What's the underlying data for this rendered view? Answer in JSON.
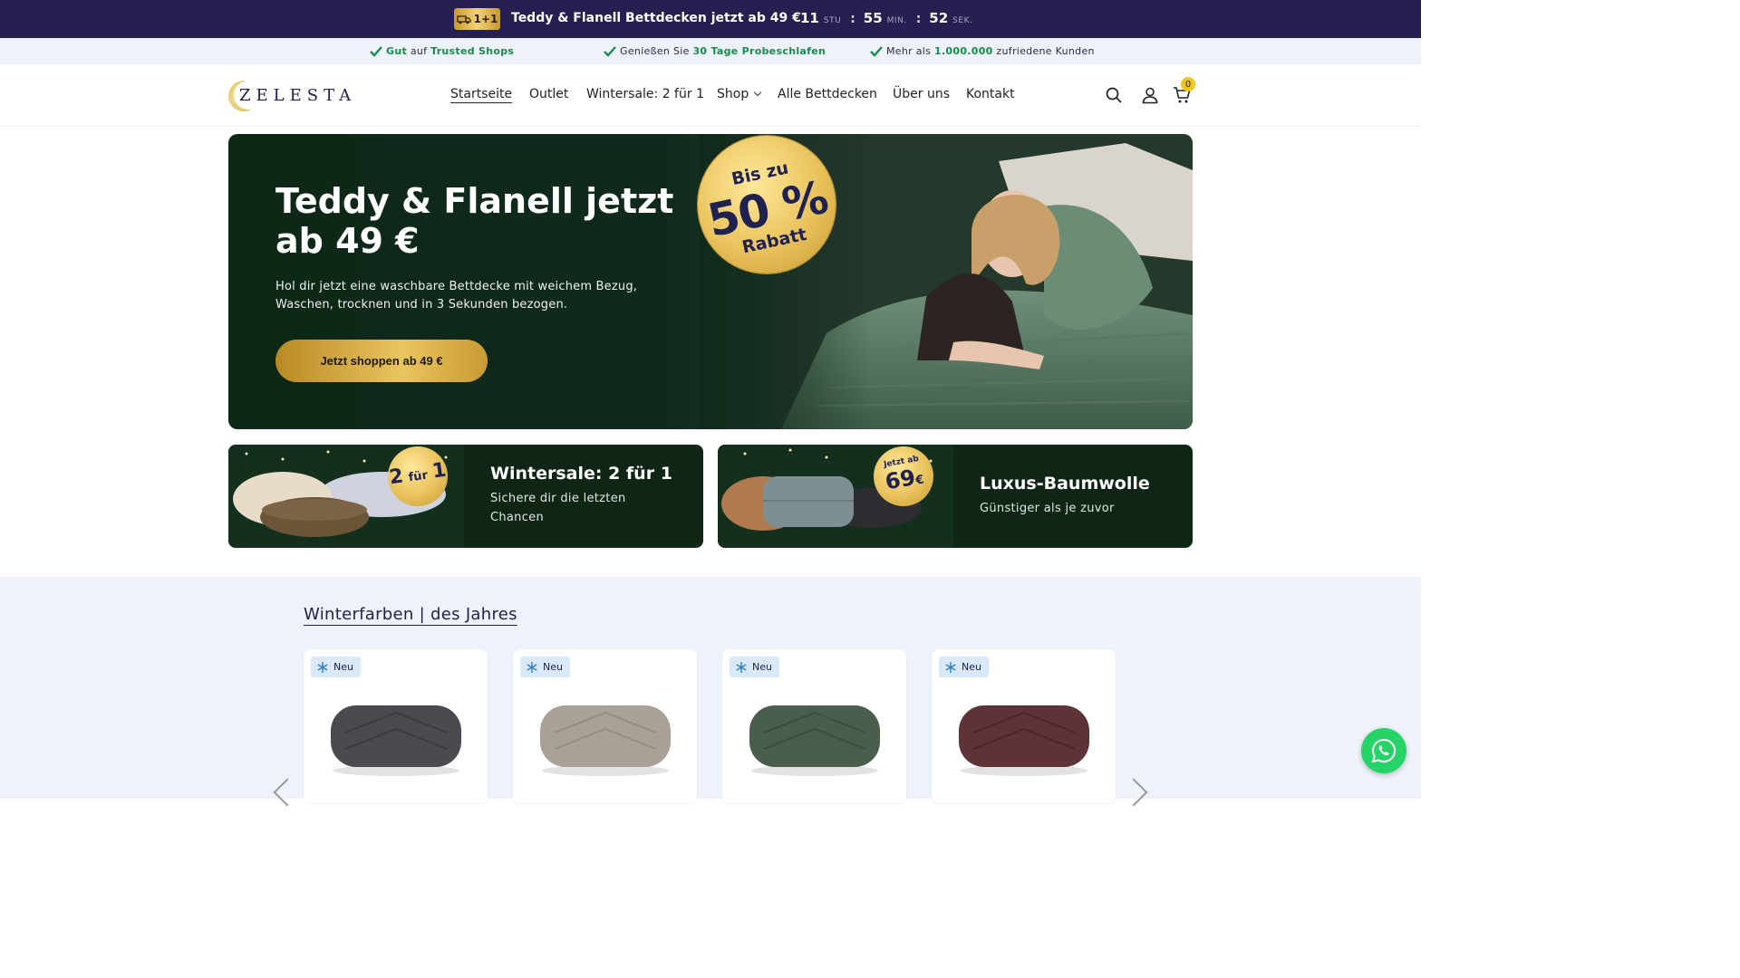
{
  "announcement": {
    "badge": "1+1",
    "message": "Teddy & Flanell Bettdecken jetzt ab 49 €",
    "timer": [
      {
        "value": "11",
        "unit": "STU"
      },
      {
        "value": "55",
        "unit": "MIN."
      },
      {
        "value": "52",
        "unit": "SEK."
      }
    ],
    "separator": ":"
  },
  "trust": [
    {
      "pre": "Gut",
      "mid": " auf ",
      "em": "Trusted Shops",
      "post": ""
    },
    {
      "pre": "",
      "mid": "Genießen Sie ",
      "em": "30 Tage Probeschlafen",
      "post": ""
    },
    {
      "pre": "",
      "mid": "Mehr als ",
      "em": "1.000.000",
      "post": " zufriedene Kunden"
    }
  ],
  "logo": "ZELESTA",
  "nav": [
    {
      "label": "Startseite",
      "active": true
    },
    {
      "label": "Outlet"
    },
    {
      "label": "Wintersale: 2 für 1"
    },
    {
      "label": "Shop"
    },
    {
      "label": "Alle Bettdecken"
    },
    {
      "label": "Über uns"
    },
    {
      "label": "Kontakt"
    }
  ],
  "header_icons": [
    "search-icon",
    "account-icon",
    "cart-icon"
  ],
  "cart_count": "0",
  "hero": {
    "title": "Teddy & Flanell jetzt ab 49 €",
    "text": "Hol dir jetzt eine waschbare Bettdecke mit weichem Bezug, Waschen, trocknen und in 3 Sekunden bezogen.",
    "cta": "Jetzt shoppen ab 49 €",
    "seal": {
      "line1": "Bis zu",
      "line2": "50 %",
      "line3": "Rabatt"
    }
  },
  "promos": [
    {
      "title": "Wintersale: 2 für 1",
      "subtitle": "Sichere dir die letzten Chancen",
      "badge_big": "2",
      "badge_small": "für",
      "badge_end": "1"
    },
    {
      "title": "Luxus-Baumwolle",
      "subtitle": "Günstiger als je zuvor",
      "badge_small": "Jetzt ab",
      "badge_big": "69",
      "badge_end": "€"
    }
  ],
  "section_title": "Winterfarben | des Jahres",
  "products": [
    {
      "tag": "Neu",
      "color": "#4a4b50"
    },
    {
      "tag": "Neu",
      "color": "#a9a197"
    },
    {
      "tag": "Neu",
      "color": "#4a5e4d"
    },
    {
      "tag": "Neu",
      "color": "#5e3236"
    }
  ],
  "colors": {
    "announce_bg": "#25204f",
    "hero_bg": "#0e2818",
    "gold": "#e9c25b",
    "trust_green": "#1a8a4b",
    "whatsapp": "#25d366"
  }
}
